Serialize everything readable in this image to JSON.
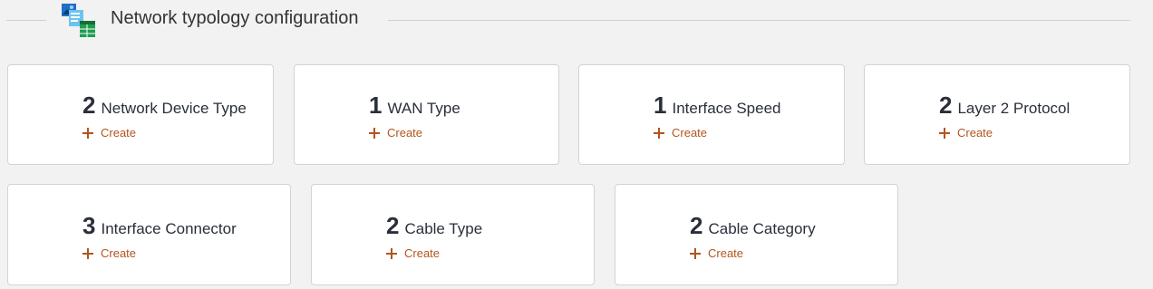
{
  "section": {
    "title": "Network typology configuration",
    "icon": "network-config-icon"
  },
  "colors": {
    "background": "#f2f2f2",
    "card_border": "#d3d3d3",
    "text_dark": "#2a2f3a",
    "accent": "#b3541e"
  },
  "cards": [
    {
      "count": "2",
      "label": "Network Device Type",
      "action": "Create"
    },
    {
      "count": "1",
      "label": "WAN Type",
      "action": "Create"
    },
    {
      "count": "1",
      "label": "Interface Speed",
      "action": "Create"
    },
    {
      "count": "2",
      "label": "Layer 2 Protocol",
      "action": "Create"
    },
    {
      "count": "3",
      "label": "Interface Connector",
      "action": "Create"
    },
    {
      "count": "2",
      "label": "Cable Type",
      "action": "Create"
    },
    {
      "count": "2",
      "label": "Cable Category",
      "action": "Create"
    }
  ]
}
